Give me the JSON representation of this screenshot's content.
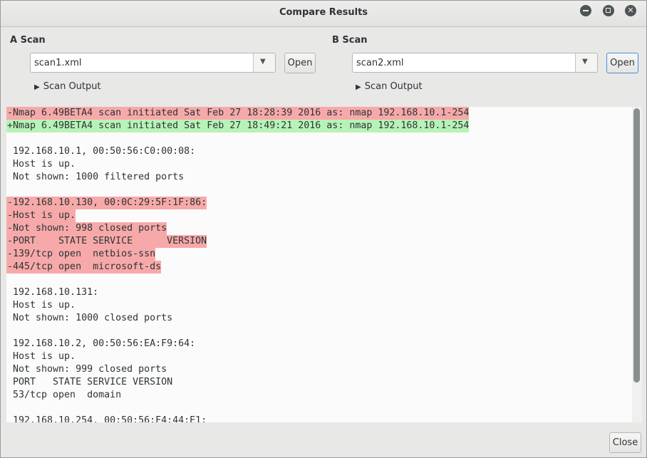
{
  "window": {
    "title": "Compare Results"
  },
  "scan_a": {
    "label": "A Scan",
    "file": "scan1.xml",
    "open_label": "Open",
    "output_label": "Scan Output"
  },
  "scan_b": {
    "label": "B Scan",
    "file": "scan2.xml",
    "open_label": "Open",
    "output_label": "Scan Output"
  },
  "diff_lines": [
    {
      "kind": "del",
      "text": "-Nmap 6.49BETA4 scan initiated Sat Feb 27 18:28:39 2016 as: nmap 192.168.10.1-254"
    },
    {
      "kind": "add",
      "text": "+Nmap 6.49BETA4 scan initiated Sat Feb 27 18:49:21 2016 as: nmap 192.168.10.1-254"
    },
    {
      "kind": "same",
      "text": ""
    },
    {
      "kind": "same",
      "text": " 192.168.10.1, 00:50:56:C0:00:08:"
    },
    {
      "kind": "same",
      "text": " Host is up."
    },
    {
      "kind": "same",
      "text": " Not shown: 1000 filtered ports"
    },
    {
      "kind": "same",
      "text": ""
    },
    {
      "kind": "del",
      "text": "-192.168.10.130, 00:0C:29:5F:1F:86:"
    },
    {
      "kind": "del",
      "text": "-Host is up."
    },
    {
      "kind": "del",
      "text": "-Not shown: 998 closed ports"
    },
    {
      "kind": "del",
      "text": "-PORT    STATE SERVICE      VERSION"
    },
    {
      "kind": "del",
      "text": "-139/tcp open  netbios-ssn"
    },
    {
      "kind": "del",
      "text": "-445/tcp open  microsoft-ds"
    },
    {
      "kind": "same",
      "text": ""
    },
    {
      "kind": "same",
      "text": " 192.168.10.131:"
    },
    {
      "kind": "same",
      "text": " Host is up."
    },
    {
      "kind": "same",
      "text": " Not shown: 1000 closed ports"
    },
    {
      "kind": "same",
      "text": ""
    },
    {
      "kind": "same",
      "text": " 192.168.10.2, 00:50:56:EA:F9:64:"
    },
    {
      "kind": "same",
      "text": " Host is up."
    },
    {
      "kind": "same",
      "text": " Not shown: 999 closed ports"
    },
    {
      "kind": "same",
      "text": " PORT   STATE SERVICE VERSION"
    },
    {
      "kind": "same",
      "text": " 53/tcp open  domain"
    },
    {
      "kind": "same",
      "text": ""
    },
    {
      "kind": "same",
      "text": " 192.168.10.254, 00:50:56:F4:44:E1:"
    }
  ],
  "footer": {
    "close_label": "Close"
  },
  "colors": {
    "deleted_bg": "#f7a9a9",
    "added_bg": "#b7f3b7",
    "focus_border": "#4a90d9"
  }
}
